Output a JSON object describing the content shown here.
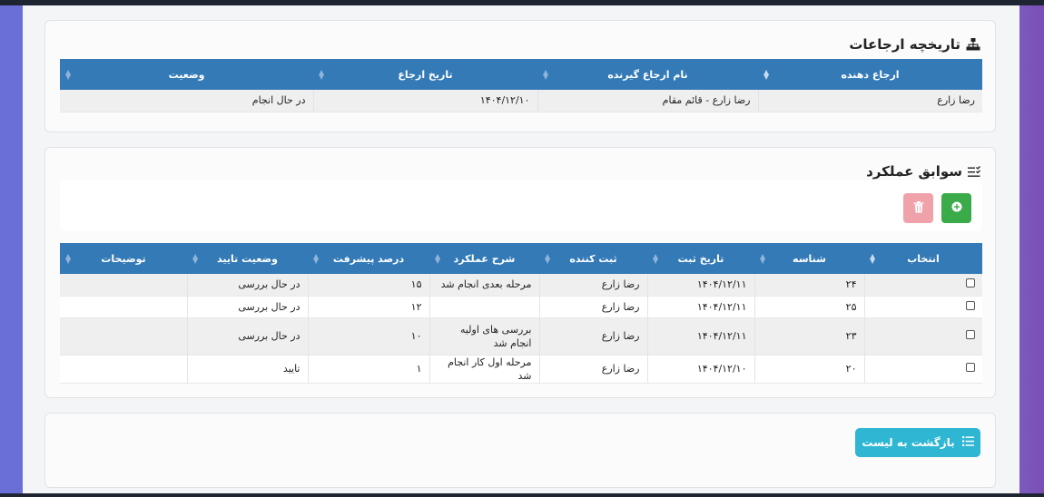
{
  "referrals": {
    "title": "تاریخچه ارجاعات",
    "icon": "sitemap-icon",
    "columns": [
      "ارجاع دهنده",
      "نام ارجاع گیرنده",
      "تاریخ ارجاع",
      "وضعیت"
    ],
    "rows": [
      [
        "رضا زارع",
        "رضا زارع - قائم مقام",
        "۱۴۰۴/۱۲/۱۰",
        "در حال انجام"
      ]
    ]
  },
  "performance": {
    "title": "سوابق عملکرد",
    "icon": "list-check-icon",
    "add_icon": "plus-circle-icon",
    "delete_icon": "trash-icon",
    "columns": [
      "انتخاب",
      "شناسه",
      "تاریخ ثبت",
      "ثبت کننده",
      "شرح عملکرد",
      "درصد پیشرفت",
      "وضعیت تایید",
      "توضیحات"
    ],
    "rows": [
      [
        "",
        "۲۴",
        "۱۴۰۴/۱۲/۱۱",
        "رضا زارع",
        "مرحله بعدی انجام شد",
        "۱۵",
        "در حال بررسی",
        ""
      ],
      [
        "",
        "۲۵",
        "۱۴۰۴/۱۲/۱۱",
        "رضا زارع",
        "",
        "۱۲",
        "در حال بررسی",
        ""
      ],
      [
        "",
        "۲۳",
        "۱۴۰۴/۱۲/۱۱",
        "رضا زارع",
        "بررسی های اولیه انجام شد",
        "۱۰",
        "در حال بررسی",
        ""
      ],
      [
        "",
        "۲۰",
        "۱۴۰۴/۱۲/۱۰",
        "رضا زارع",
        "مرحله اول کار انجام شد",
        "۱",
        "تایید",
        ""
      ]
    ]
  },
  "footer": {
    "back_label": "بازگشت به لیست",
    "back_icon": "list-icon"
  },
  "colors": {
    "header_blue": "#337ab7",
    "add_green": "#3bab4a",
    "delete_pink": "#f0a2aa",
    "back_cyan": "#2fb6d3"
  }
}
